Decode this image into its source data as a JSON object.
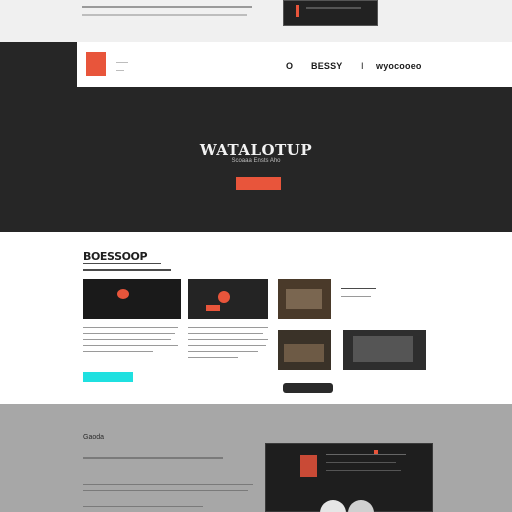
{
  "nav": {
    "logo_text": "",
    "item_1": "O",
    "item_2": "BESSY",
    "item_3": "I",
    "item_4": "wyocooeo"
  },
  "hero": {
    "title": "WATALOTUP",
    "subtitle": "Scoaaa Ensts Aho",
    "button_label": ""
  },
  "section": {
    "title": "BOESSOOP"
  },
  "bottom": {
    "title": "Gaoda"
  },
  "colors": {
    "accent": "#e8553b",
    "dark": "#262626",
    "cyan": "#1fe0e0"
  }
}
